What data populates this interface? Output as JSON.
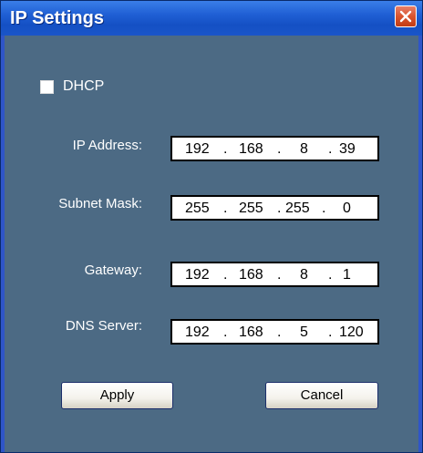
{
  "window": {
    "title": "IP Settings"
  },
  "dhcp": {
    "label": "DHCP",
    "checked": false
  },
  "fields": [
    {
      "label": "IP Address:",
      "octets": [
        "192",
        "168",
        "8",
        "39"
      ]
    },
    {
      "label": "Subnet Mask:",
      "octets": [
        "255",
        "255",
        "255",
        "0"
      ]
    },
    {
      "label": "Gateway:",
      "octets": [
        "192",
        "168",
        "8",
        "1"
      ]
    },
    {
      "label": "DNS Server:",
      "octets": [
        "192",
        "168",
        "5",
        "120"
      ]
    }
  ],
  "separator": ".",
  "buttons": {
    "apply": "Apply",
    "cancel": "Cancel"
  },
  "colors": {
    "dialog_background": "#4c6a84",
    "titlebar": "#1f5fd4",
    "close_button": "#d9542e"
  },
  "icons": {
    "close": "close-icon"
  }
}
